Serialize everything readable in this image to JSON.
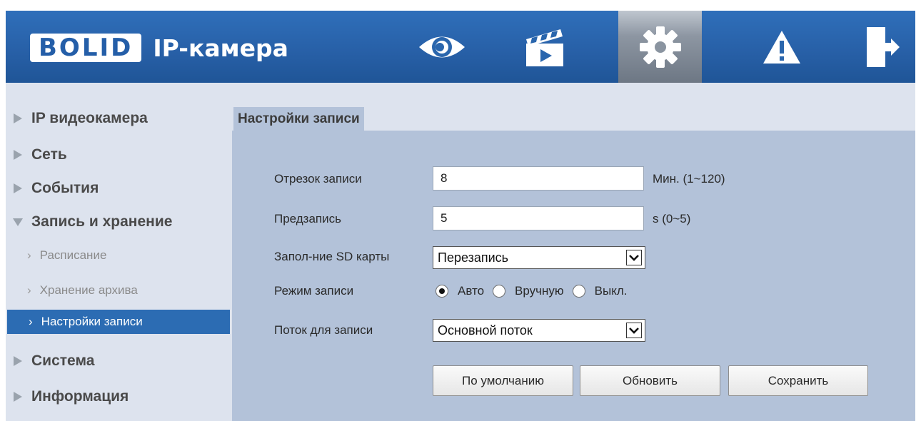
{
  "header": {
    "logo_brand": "BOLID",
    "logo_title": "IP-камера",
    "tabs": [
      {
        "icon": "eye-icon",
        "label": "Просмотр"
      },
      {
        "icon": "clapperboard-icon",
        "label": "Воспроизведение"
      },
      {
        "icon": "gear-icon",
        "label": "Настройки",
        "active": true
      },
      {
        "icon": "warning-icon",
        "label": "Тревоги"
      },
      {
        "icon": "logout-icon",
        "label": "Выход"
      }
    ]
  },
  "sidebar": {
    "items": [
      {
        "label": "IP видеокамера",
        "level": 1,
        "expanded": false
      },
      {
        "label": "Сеть",
        "level": 1,
        "expanded": false
      },
      {
        "label": "События",
        "level": 1,
        "expanded": false
      },
      {
        "label": "Запись и хранение",
        "level": 1,
        "expanded": true
      },
      {
        "label": "Расписание",
        "level": 2
      },
      {
        "label": "Хранение архива",
        "level": 2
      },
      {
        "label": "Настройки записи",
        "level": 2,
        "active": true
      },
      {
        "label": "Система",
        "level": 1,
        "expanded": false
      },
      {
        "label": "Информация",
        "level": 1,
        "expanded": false
      }
    ]
  },
  "main": {
    "tab_label": "Настройки записи",
    "form": {
      "record_segment": {
        "label": "Отрезок записи",
        "value": "8",
        "hint": "Мин. (1~120)"
      },
      "prerecord": {
        "label": "Предзапись",
        "value": "5",
        "hint": "s (0~5)"
      },
      "sd_fill": {
        "label": "Запол-ние SD карты",
        "value": "Перезапись"
      },
      "record_mode": {
        "label": "Режим записи",
        "options": [
          "Авто",
          "Вручную",
          "Выкл."
        ],
        "selected": "Авто"
      },
      "stream": {
        "label": "Поток для записи",
        "value": "Основной поток"
      }
    },
    "buttons": {
      "default": "По умолчанию",
      "refresh": "Обновить",
      "save": "Сохранить"
    }
  },
  "colors": {
    "header_blue": "#2a66ad",
    "active_item": "#2c6cb3",
    "content_bg": "#b3c2d9",
    "sidebar_bg": "#dde3ee"
  }
}
